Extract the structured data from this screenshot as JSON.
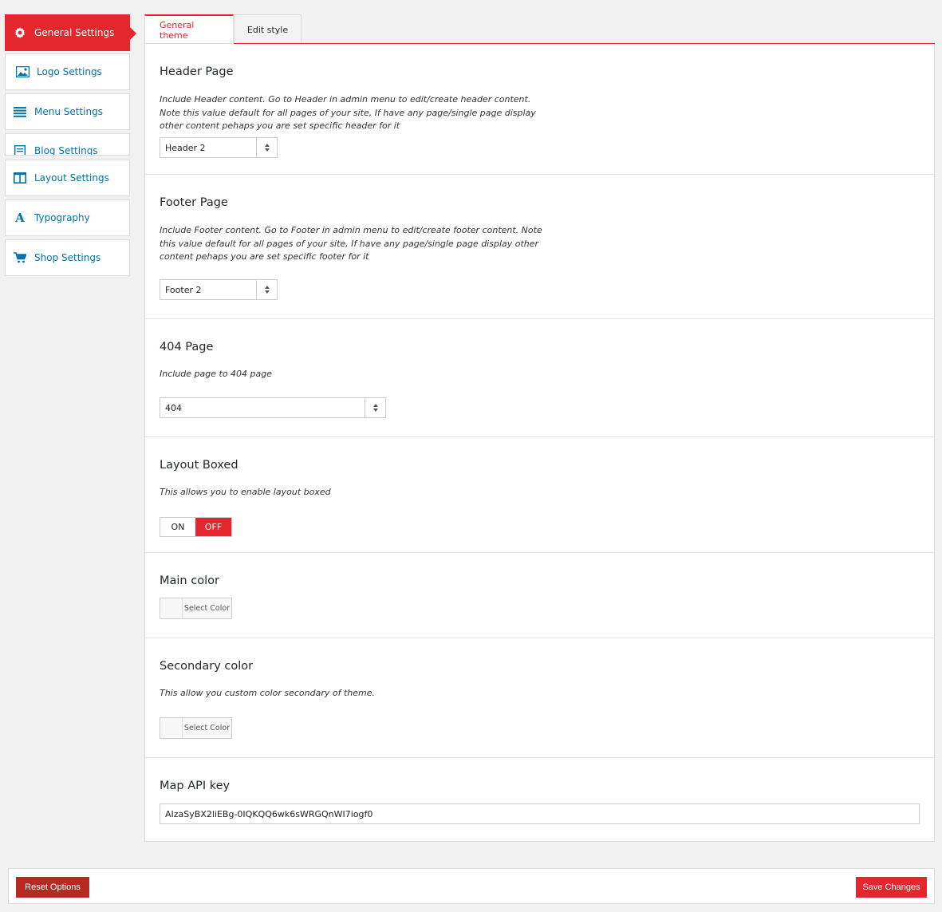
{
  "sidebar": {
    "items": [
      {
        "label": "General Settings",
        "icon": "gear-icon"
      },
      {
        "label": "Logo Settings",
        "icon": "image-icon"
      },
      {
        "label": "Menu Settings",
        "icon": "menu-icon"
      },
      {
        "label": "Blog Settings",
        "icon": "document-icon"
      },
      {
        "label": "Layout Settings",
        "icon": "columns-icon"
      },
      {
        "label": "Typography",
        "icon": "typography-icon"
      },
      {
        "label": "Shop Settings",
        "icon": "cart-icon"
      }
    ]
  },
  "tabs": [
    {
      "label": "General theme",
      "active": true
    },
    {
      "label": "Edit style",
      "active": false
    }
  ],
  "sections": {
    "header": {
      "title": "Header Page",
      "desc": "Include Header content. Go to Header in admin menu to edit/create header content. Note this value default for all pages of your site, If have any page/single page display other content pehaps you are set specific header for it",
      "value": "Header 2"
    },
    "footer": {
      "title": "Footer Page",
      "desc": "Include Footer content. Go to Footer in admin menu to edit/create footer content. Note this value default for all pages of your site, If have any page/single page display other content pehaps you are set specific footer for it",
      "value": "Footer 2"
    },
    "page404": {
      "title": "404 Page",
      "desc": "Include page to 404 page",
      "value": "404"
    },
    "layout_boxed": {
      "title": "Layout Boxed",
      "desc": "This allows you to enable layout boxed",
      "on_label": "ON",
      "off_label": "OFF",
      "state": "off"
    },
    "main_color": {
      "title": "Main color",
      "button": "Select Color"
    },
    "secondary_color": {
      "title": "Secondary color",
      "desc": "This allow you custom color secondary of theme.",
      "button": "Select Color"
    },
    "map_api": {
      "title": "Map API key",
      "value": "AIzaSyBX2liEBg-0IQKQQ6wk6sWRGQnWI7iogf0"
    }
  },
  "footer_bar": {
    "reset_label": "Reset Options",
    "save_label": "Save Changes"
  },
  "colors": {
    "accent": "#e5262e",
    "reset": "#b52a22",
    "link": "#0073aa"
  }
}
